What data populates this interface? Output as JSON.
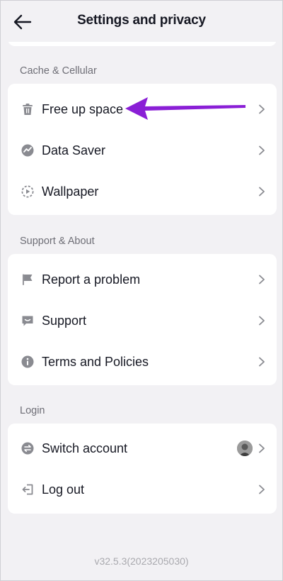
{
  "header": {
    "title": "Settings and privacy",
    "back_icon": "arrow-left-icon"
  },
  "sections": [
    {
      "label": "Cache & Cellular",
      "items": [
        {
          "label": "Free up space",
          "icon": "trash-icon"
        },
        {
          "label": "Data Saver",
          "icon": "data-saver-icon"
        },
        {
          "label": "Wallpaper",
          "icon": "wallpaper-icon"
        }
      ]
    },
    {
      "label": "Support & About",
      "items": [
        {
          "label": "Report a problem",
          "icon": "flag-icon"
        },
        {
          "label": "Support",
          "icon": "chat-icon"
        },
        {
          "label": "Terms and Policies",
          "icon": "info-icon"
        }
      ]
    },
    {
      "label": "Login",
      "items": [
        {
          "label": "Switch account",
          "icon": "switch-account-icon"
        },
        {
          "label": "Log out",
          "icon": "logout-icon"
        }
      ]
    }
  ],
  "footer": {
    "version": "v32.5.3(2023205030)"
  },
  "colors": {
    "background": "#f2f1f4",
    "card": "#ffffff",
    "text": "#161823",
    "section_label": "#6e6e76",
    "icon": "#8a8b91",
    "annotation_arrow": "#8a1fd6"
  }
}
